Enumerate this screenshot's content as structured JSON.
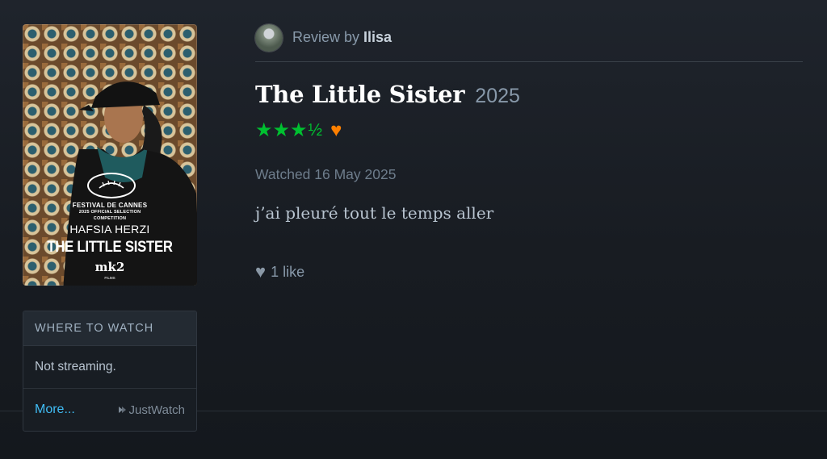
{
  "poster": {
    "festival_line1": "FESTIVAL DE CANNES",
    "festival_line2": "2025 OFFICIAL SELECTION",
    "festival_line3": "COMPETITION",
    "director": "HAFSIA HERZI",
    "title": "THE LITTLE SISTER",
    "distributor": "mk2",
    "distributor_sub": "FILMS"
  },
  "where_to_watch": {
    "header": "WHERE TO WATCH",
    "status": "Not streaming.",
    "more_label": "More...",
    "provider": "JustWatch"
  },
  "review": {
    "review_by_prefix": "Review by",
    "username": "Ilisa",
    "film_title": "The Little Sister",
    "year": "2025",
    "rating_stars": 3.5,
    "stars_full": "★★★",
    "stars_half": "½",
    "liked": true,
    "watched": "Watched 16 May 2025",
    "text": "j’ai pleuré tout le temps aller",
    "likes_label": "1 like"
  },
  "colors": {
    "background": "#1c2128",
    "star_green": "#00c030",
    "like_orange": "#ff8000",
    "link_blue": "#40bcf4"
  },
  "icons": {
    "like": "heart-icon",
    "provider": "justwatch-icon"
  }
}
